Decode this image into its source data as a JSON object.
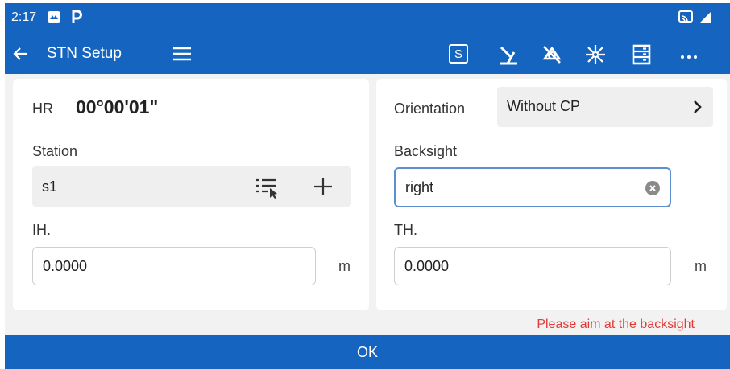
{
  "status_bar": {
    "time": "2:17",
    "icons": [
      "photos-icon",
      "parking-icon",
      "cast-icon",
      "signal-icon"
    ]
  },
  "toolbar": {
    "back_icon": "arrow-left-icon",
    "title": "STN Setup",
    "menu_icon": "hamburger-menu-icon",
    "s_button_label": "S",
    "tools": [
      "laser-icon",
      "no-prism-icon",
      "sparkle-icon",
      "list-icon",
      "more-icon"
    ]
  },
  "left_panel": {
    "hr_label": "HR",
    "hr_value": "00°00'01\"",
    "station_label": "Station",
    "station_value": "s1",
    "ih_label": "IH.",
    "ih_value": "0.0000",
    "ih_unit": "m"
  },
  "right_panel": {
    "orientation_label": "Orientation",
    "orientation_value": "Without CP",
    "backsight_label": "Backsight",
    "backsight_value": "right",
    "th_label": "TH.",
    "th_value": "0.0000",
    "th_unit": "m"
  },
  "warning": "Please aim at the backsight",
  "ok_label": "OK",
  "colors": {
    "primary": "#1565c0",
    "warning": "#e53935",
    "focus_border": "#5b8fd1"
  }
}
